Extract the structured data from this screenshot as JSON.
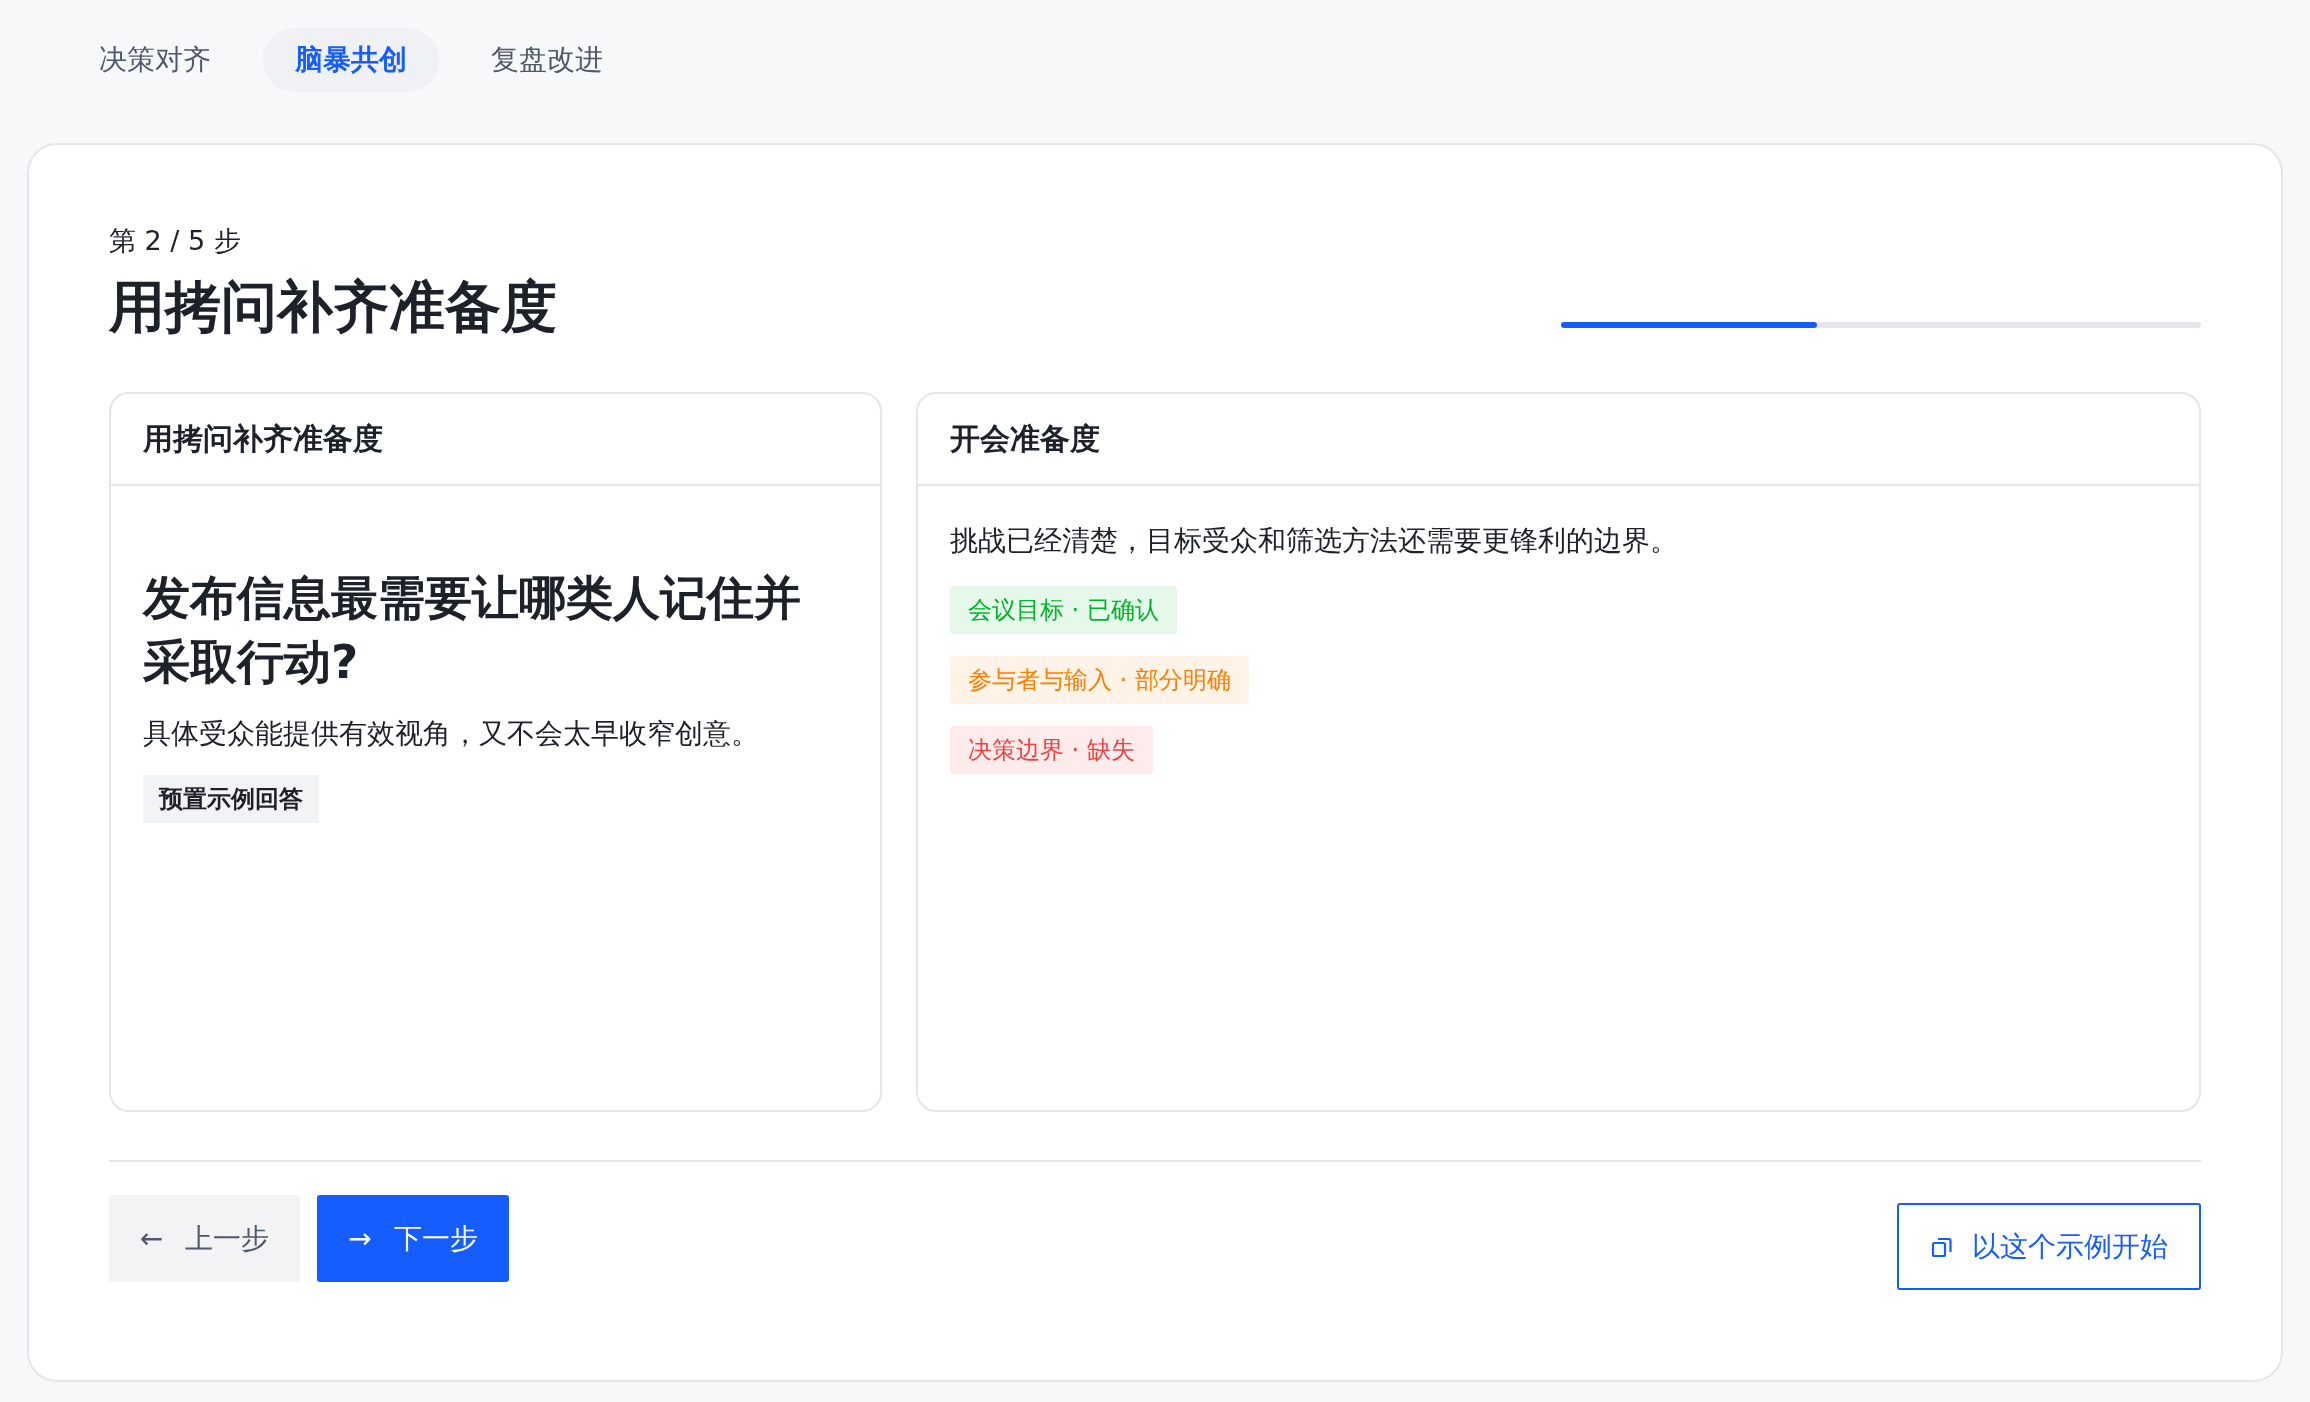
{
  "tabs": [
    {
      "label": "决策对齐",
      "selected": false
    },
    {
      "label": "脑暴共创",
      "selected": true
    },
    {
      "label": "复盘改进",
      "selected": false
    }
  ],
  "step": {
    "counter": "第 2 / 5 步",
    "title": "用拷问补齐准备度",
    "progress": {
      "level": 0.4
    }
  },
  "question_panel": {
    "header": "用拷问补齐准备度",
    "question": "发布信息最需要让哪类人记住并采取行动?",
    "description": "具体受众能提供有效视角，又不会太早收窄创意。",
    "tag": "预置示例回答"
  },
  "readiness_panel": {
    "header": "开会准备度",
    "summary": "挑战已经清楚，目标受众和筛选方法还需要更锋利的边界。",
    "items": [
      {
        "label": "会议目标 · 已确认",
        "color": "#00b42a"
      },
      {
        "label": "参与者与输入 · 部分明确",
        "color": "#ff7d00"
      },
      {
        "label": "决策边界 · 缺失",
        "color": "#f53f3f"
      }
    ]
  },
  "footer": {
    "prev_button": {
      "icon": "←",
      "label": "上一步"
    },
    "next_button": {
      "icon": "→",
      "label": "下一步"
    },
    "start_button": {
      "label": "以这个示例开始"
    }
  }
}
